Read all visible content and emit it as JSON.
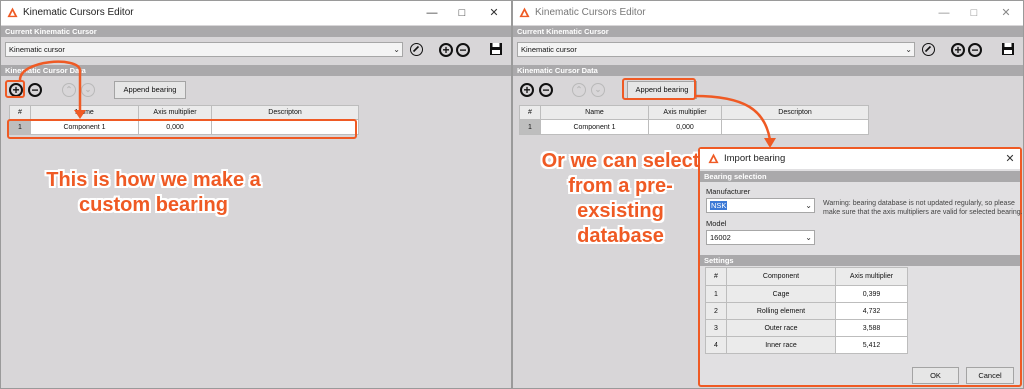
{
  "window": {
    "title": "Kinematic Cursors Editor"
  },
  "sections": {
    "current": "Current Kinematic Cursor",
    "data": "Kinematic Cursor Data"
  },
  "cursor_select": {
    "value": "Kinematic cursor"
  },
  "toolbar": {
    "append_bearing": "Append bearing"
  },
  "grid": {
    "headers": [
      "#",
      "Name",
      "Axis multiplier",
      "Descripton"
    ],
    "rows": [
      {
        "idx": "1",
        "name": "Component 1",
        "axis": "0,000",
        "desc": ""
      }
    ]
  },
  "annotations": {
    "left_text": "This is how we make a custom bearing",
    "right_text": "Or we can select from a pre-exsisting database"
  },
  "dialog": {
    "title": "Import bearing",
    "bearing_selection": "Bearing selection",
    "manufacturer_label": "Manufacturer",
    "manufacturer_value": "NSK",
    "model_label": "Model",
    "model_value": "16002",
    "warning": "Warning: bearing database is not updated regularly, so please make sure that the axis multipliers are valid for selected bearing.",
    "settings": "Settings",
    "headers": [
      "#",
      "Component",
      "Axis multiplier"
    ],
    "rows": [
      {
        "idx": "1",
        "component": "Cage",
        "axis": "0,399"
      },
      {
        "idx": "2",
        "component": "Rolling element",
        "axis": "4,732"
      },
      {
        "idx": "3",
        "component": "Outer race",
        "axis": "3,588"
      },
      {
        "idx": "4",
        "component": "Inner race",
        "axis": "5,412"
      }
    ],
    "ok": "OK",
    "cancel": "Cancel"
  },
  "colors": {
    "accent": "#ef5a24",
    "section_header": "#aaa9ab",
    "window_bg": "#d8d6d8"
  },
  "icons": [
    "app-logo-icon",
    "minimize-icon",
    "maximize-icon",
    "close-icon",
    "edit-icon",
    "add-icon",
    "remove-icon",
    "save-icon",
    "move-up-icon",
    "move-down-icon",
    "dropdown-chevron-icon"
  ]
}
